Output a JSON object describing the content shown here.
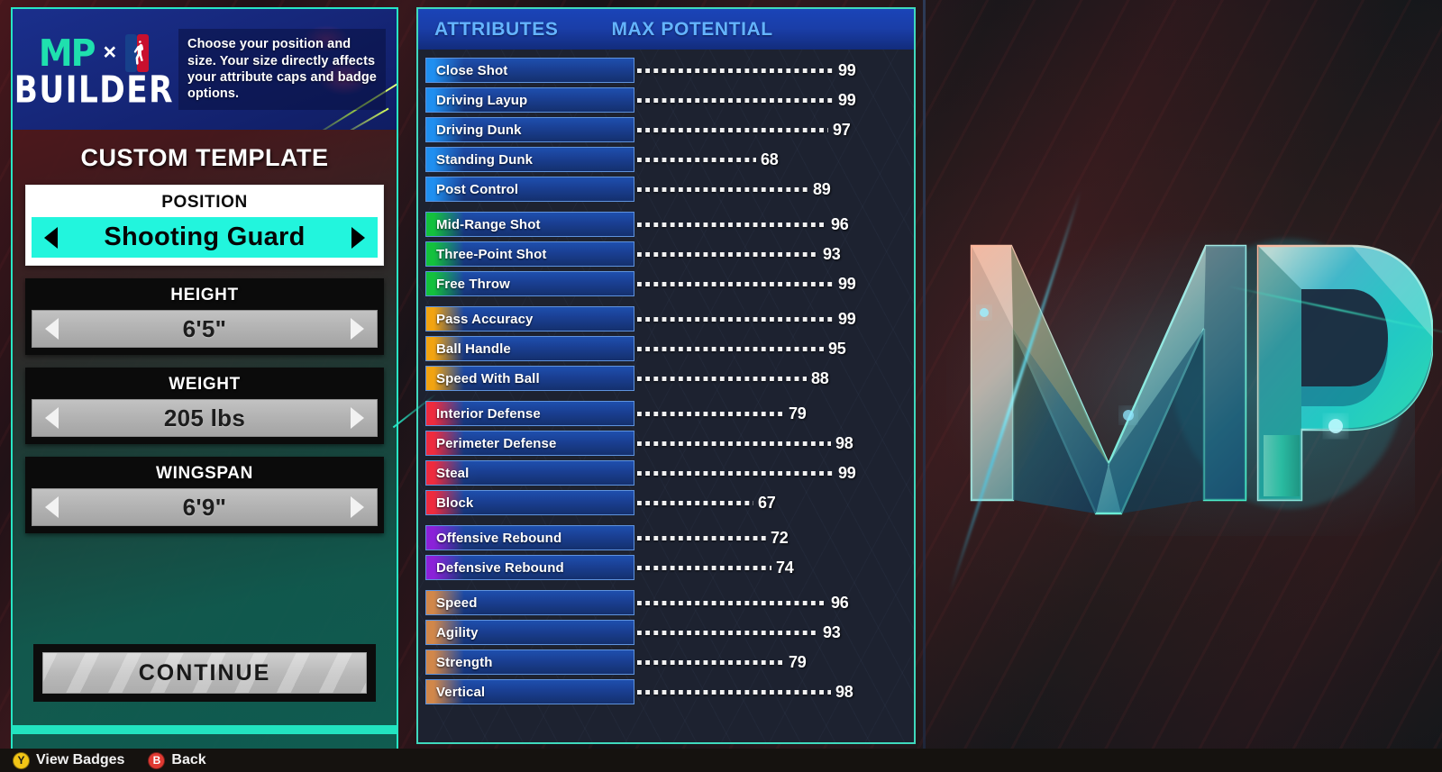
{
  "brand": {
    "mp_mark": "MP",
    "cross": "×",
    "builder_word": "BUILDER",
    "nba_logo_name": "nba-logo",
    "description": "Choose your position and size. Your size directly affects your attribute caps and badge options."
  },
  "left_panel": {
    "title": "CUSTOM TEMPLATE",
    "fields": [
      {
        "label": "POSITION",
        "value": "Shooting Guard",
        "highlighted": true
      },
      {
        "label": "HEIGHT",
        "value": "6'5\"",
        "highlighted": false
      },
      {
        "label": "WEIGHT",
        "value": "205 lbs",
        "highlighted": false
      },
      {
        "label": "WINGSPAN",
        "value": "6'9\"",
        "highlighted": false
      }
    ],
    "continue_label": "CONTINUE"
  },
  "bottom_bar": {
    "prompts": [
      {
        "glyph": "Y",
        "button": "y",
        "label": "View Badges"
      },
      {
        "glyph": "B",
        "button": "b",
        "label": "Back"
      }
    ]
  },
  "attributes_panel": {
    "header": {
      "left": "ATTRIBUTES",
      "right": "MAX POTENTIAL"
    },
    "max_value": 99,
    "groups": [
      {
        "category": "inside-scoring",
        "accent_color": "#1f8ff0",
        "rows": [
          {
            "name": "Close Shot",
            "value": 99
          },
          {
            "name": "Driving Layup",
            "value": 99
          },
          {
            "name": "Driving Dunk",
            "value": 97
          },
          {
            "name": "Standing Dunk",
            "value": 68
          },
          {
            "name": "Post Control",
            "value": 89
          }
        ]
      },
      {
        "category": "shooting",
        "accent_color": "#13c13d",
        "rows": [
          {
            "name": "Mid-Range Shot",
            "value": 96
          },
          {
            "name": "Three-Point Shot",
            "value": 93
          },
          {
            "name": "Free Throw",
            "value": 99
          }
        ]
      },
      {
        "category": "playmaking",
        "accent_color": "#f2a310",
        "rows": [
          {
            "name": "Pass Accuracy",
            "value": 99
          },
          {
            "name": "Ball Handle",
            "value": 95
          },
          {
            "name": "Speed With Ball",
            "value": 88
          }
        ]
      },
      {
        "category": "defense",
        "accent_color": "#ef2b3e",
        "rows": [
          {
            "name": "Interior Defense",
            "value": 79
          },
          {
            "name": "Perimeter Defense",
            "value": 98
          },
          {
            "name": "Steal",
            "value": 99
          },
          {
            "name": "Block",
            "value": 67
          }
        ]
      },
      {
        "category": "rebounding",
        "accent_color": "#8b21d8",
        "rows": [
          {
            "name": "Offensive Rebound",
            "value": 72
          },
          {
            "name": "Defensive Rebound",
            "value": 74
          }
        ]
      },
      {
        "category": "physicals",
        "accent_color": "#d1874a",
        "rows": [
          {
            "name": "Speed",
            "value": 96
          },
          {
            "name": "Agility",
            "value": 93
          },
          {
            "name": "Strength",
            "value": 79
          },
          {
            "name": "Vertical",
            "value": 98
          }
        ]
      }
    ]
  },
  "hero_logo": {
    "name": "mp-hero-logo",
    "letters": "MP",
    "colors": {
      "peach": "#f0a48c",
      "cyan": "#2fe3e8",
      "teal": "#25c79b",
      "deep_blue": "#1d4a7a"
    }
  }
}
